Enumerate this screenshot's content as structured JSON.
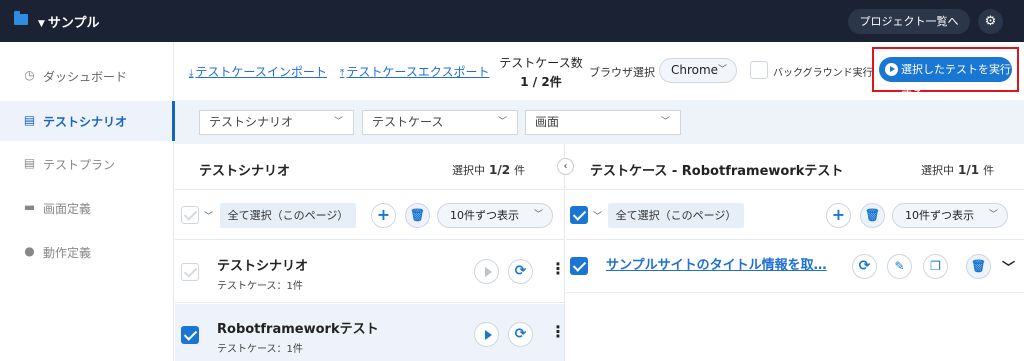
{
  "header": {
    "project_name": "サンプル",
    "project_list_label": "プロジェクト一覧へ",
    "folder_icon": "folder-icon",
    "gear_icon": "gear-icon"
  },
  "sidebar": {
    "items": [
      {
        "label": "ダッシュボード",
        "icon": "clock-icon"
      },
      {
        "label": "テストシナリオ",
        "icon": "document-icon",
        "active": true
      },
      {
        "label": "テストプラン",
        "icon": "document-icon"
      },
      {
        "label": "画面定義",
        "icon": "monitor-icon"
      },
      {
        "label": "動作定義",
        "icon": "check-circle-icon"
      }
    ]
  },
  "toolbar": {
    "import_label": "テストケースインポート",
    "export_label": "テストケースエクスポート",
    "testcase_count_label": "テストケース数",
    "testcase_count_value": "1 / 2件",
    "browser_label": "ブラウザ選択",
    "browser_value": "Chrome",
    "background_label": "バックグラウンド実行",
    "run_label": "選択したテストを実行する",
    "accent_color": "#1976d2",
    "highlight_color": "#e0141a"
  },
  "filters": {
    "scenario": "テストシナリオ",
    "testcase": "テストケース",
    "screen": "画面"
  },
  "left_panel": {
    "title": "テストシナリオ",
    "selected_label": "選択中",
    "selected_value": "1/2",
    "selected_unit": "件",
    "select_all_label": "全て選択（このページ）",
    "page_size": "10件ずつ表示",
    "rows": [
      {
        "title": "テストシナリオ",
        "subtitle": "テストケース：1件",
        "checked": false
      },
      {
        "title": "Robotframeworkテスト",
        "subtitle": "テストケース：1件",
        "checked": true
      }
    ]
  },
  "right_panel": {
    "title": "テストケース - Robotframeworkテスト",
    "selected_label": "選択中",
    "selected_value": "1/1",
    "selected_unit": "件",
    "select_all_label": "全て選択（このページ）",
    "page_size": "10件ずつ表示",
    "rows": [
      {
        "title": "サンプルサイトのタイトル情報を取…",
        "checked": true
      }
    ]
  }
}
